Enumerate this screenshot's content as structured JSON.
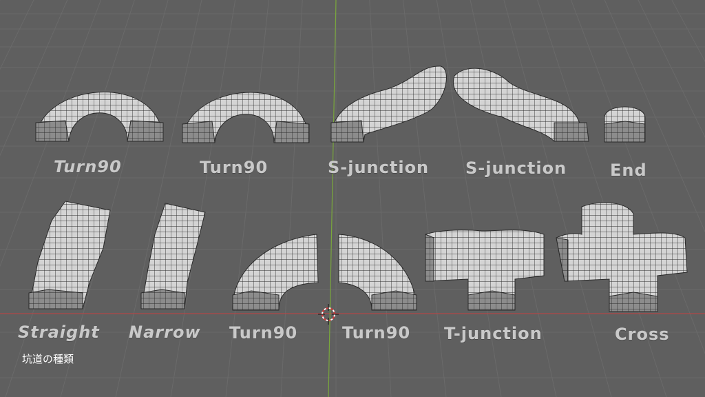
{
  "viewport": {
    "caption": "坑道の種類",
    "colors": {
      "background": "#5f5f5f",
      "x_axis": "#b04848",
      "y_axis": "#7aa83c",
      "mesh": "#d6d6d6",
      "wire": "#2a2a2a",
      "label": "#c9c9c9"
    }
  },
  "labels": {
    "row1": [
      "Turn90",
      "Turn90",
      "S-junction",
      "S-junction",
      "End"
    ],
    "row2": [
      "Straight",
      "Narrow",
      "Turn90",
      "Turn90",
      "T-junction",
      "Cross"
    ]
  },
  "icons": {
    "cursor": "3d-cursor-icon"
  }
}
